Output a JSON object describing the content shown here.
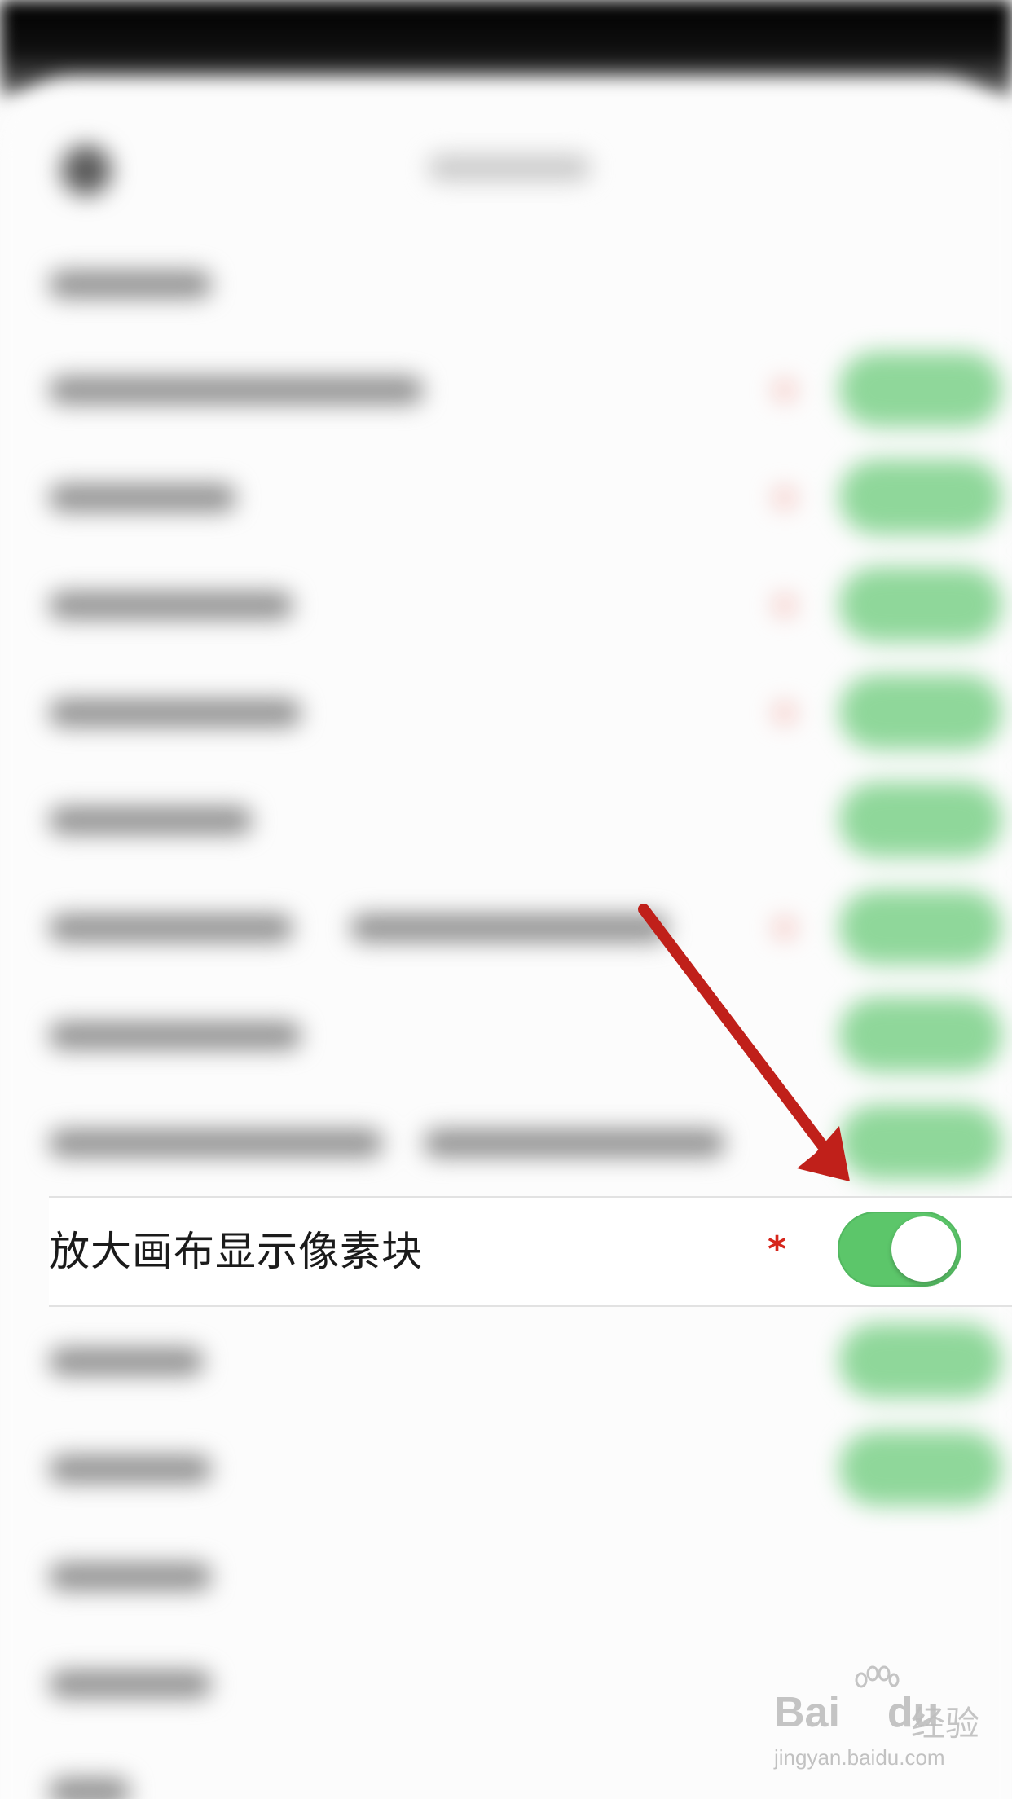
{
  "setting_row": {
    "label": "放大画布显示像素块",
    "required_mark": "*",
    "toggle_state": "on"
  },
  "colors": {
    "toggle_on": "#5cc66a",
    "required_mark": "#d6261c",
    "annotation_arrow": "#c0201a"
  },
  "watermark": {
    "brand": "Bai",
    "brand_icon": "paw-icon",
    "brand_suffix": "du",
    "cn": "经验",
    "url": "jingyan.baidu.com"
  }
}
